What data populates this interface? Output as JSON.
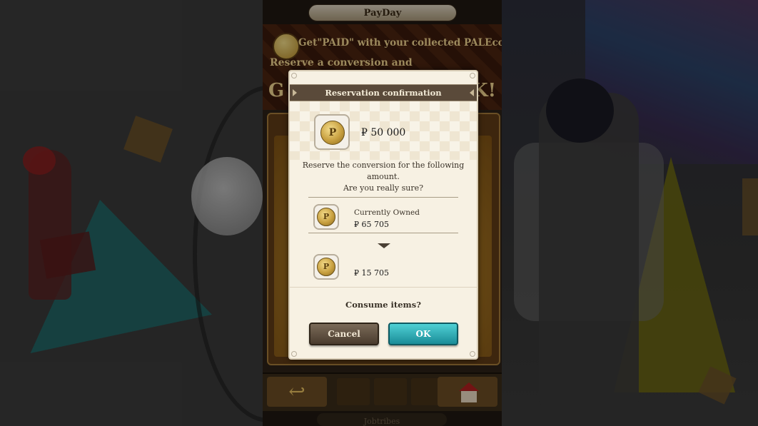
{
  "screen": {
    "title": "PayDay",
    "banner": {
      "coin_letter": "P",
      "line1": "Get\"PAID\" with your collected PALEcoin!",
      "line2": "Reserve a conversion and",
      "big_left": "G",
      "big_right": "K!"
    },
    "bottom_nav": {
      "back_label": "↩",
      "tab_label": "Jobtribes"
    }
  },
  "dialog": {
    "title": "Reservation confirmation",
    "amount": "₽ 50 000",
    "message_line1": "Reserve the conversion for the following",
    "message_line2": "amount.",
    "message_line3": "Are you really sure?",
    "owned_label": "Currently Owned",
    "owned_value": "₽ 65 705",
    "after_value": "₽ 15 705",
    "coin_letter": "P",
    "consume_prompt": "Consume items?",
    "cancel_label": "Cancel",
    "ok_label": "OK"
  },
  "colors": {
    "ok_button": "#1a8c98",
    "cancel_button": "#4a3c2e",
    "header": "#5a4a3a",
    "coin_gold": "#c8a040"
  }
}
